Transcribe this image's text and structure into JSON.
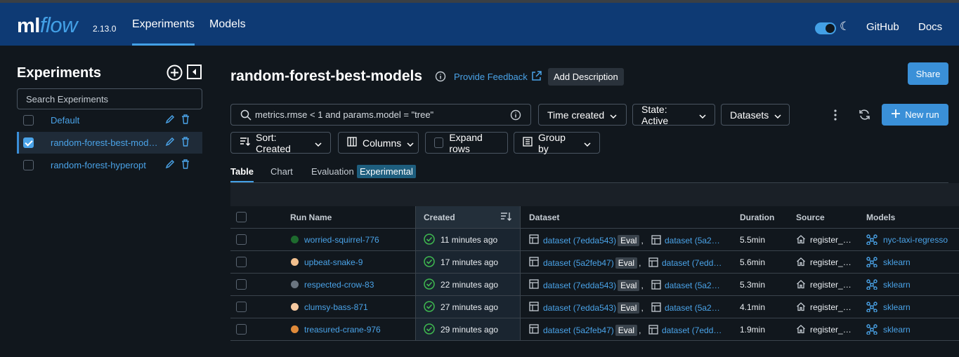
{
  "header": {
    "logo_ml": "ml",
    "logo_flow": "flow",
    "version": "2.13.0",
    "tabs": [
      "Experiments",
      "Models"
    ],
    "active_tab": "Experiments",
    "links": [
      "GitHub",
      "Docs"
    ],
    "theme_toggle": "on",
    "accent": "#43a0e6",
    "bg": "#0e3a74"
  },
  "sidebar": {
    "title": "Experiments",
    "search_placeholder": "Search Experiments",
    "items": [
      {
        "label": "Default",
        "checked": false
      },
      {
        "label": "random-forest-best-models",
        "checked": true
      },
      {
        "label": "random-forest-hyperopt",
        "checked": false
      }
    ]
  },
  "main": {
    "title": "random-forest-best-models",
    "feedback": "Provide Feedback",
    "add_description": "Add Description",
    "share": "Share",
    "search_value": "metrics.rmse < 1 and params.model = \"tree\"",
    "time_created": "Time created",
    "state": "State: Active",
    "datasets": "Datasets",
    "new_run": "New run",
    "sort": "Sort: Created",
    "columns": "Columns",
    "expand_rows": "Expand rows",
    "group_by": "Group by",
    "view_tabs": [
      "Table",
      "Chart",
      "Evaluation"
    ],
    "experimental": "Experimental"
  },
  "table": {
    "headers": [
      "Run Name",
      "Created",
      "Dataset",
      "Duration",
      "Source",
      "Models"
    ],
    "rows": [
      {
        "name": "worried-squirrel-776",
        "color": "#1e6b2e",
        "created": "11 minutes ago",
        "ds1": "dataset (7edda543)",
        "eval": "Eval",
        "ds2": "dataset (5a2…",
        "duration": "5.5min",
        "source": "register_…",
        "model": "nyc-taxi-regresso"
      },
      {
        "name": "upbeat-snake-9",
        "color": "#f2c08e",
        "created": "17 minutes ago",
        "ds1": "dataset (5a2feb47)",
        "eval": "Eval",
        "ds2": "dataset (7edd…",
        "duration": "5.6min",
        "source": "register_…",
        "model": "sklearn"
      },
      {
        "name": "respected-crow-83",
        "color": "#6b7580",
        "created": "22 minutes ago",
        "ds1": "dataset (7edda543)",
        "eval": "Eval",
        "ds2": "dataset (5a2…",
        "duration": "5.3min",
        "source": "register_…",
        "model": "sklearn"
      },
      {
        "name": "clumsy-bass-871",
        "color": "#f5c9a0",
        "created": "27 minutes ago",
        "ds1": "dataset (7edda543)",
        "eval": "Eval",
        "ds2": "dataset (5a2…",
        "duration": "4.1min",
        "source": "register_…",
        "model": "sklearn"
      },
      {
        "name": "treasured-crane-976",
        "color": "#e08a3a",
        "created": "29 minutes ago",
        "ds1": "dataset (5a2feb47)",
        "eval": "Eval",
        "ds2": "dataset (7edd…",
        "duration": "1.9min",
        "source": "register_…",
        "model": "sklearn"
      }
    ]
  }
}
